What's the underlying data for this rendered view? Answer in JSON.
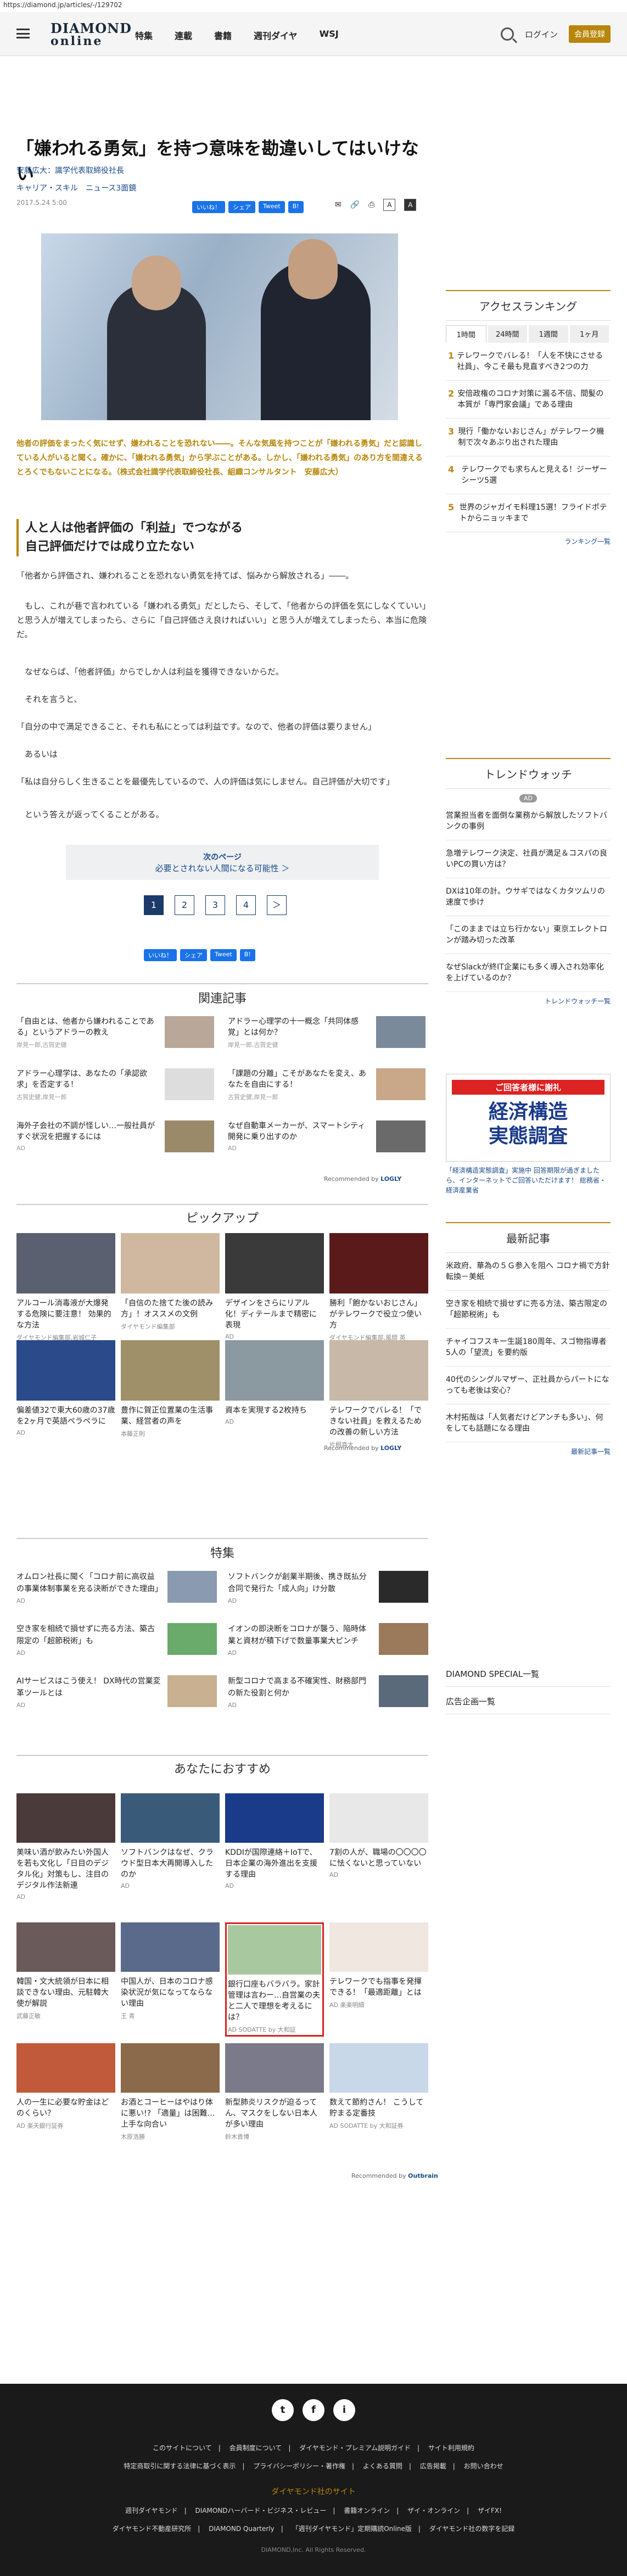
{
  "url": "https://diamond.jp/articles/-/129702",
  "header": {
    "logo1": "DIAMOND",
    "logo2": "online",
    "nav": [
      "特集",
      "連載",
      "書籍",
      "週刊ダイヤ",
      "WSJ"
    ],
    "login": "ログイン",
    "member": "会員登録"
  },
  "article": {
    "title": "「嫌われる勇気」を持つ意味を勘違いしてはいけない",
    "author": "安藤広大：識学代表取締役社長",
    "tags": "キャリア・スキル　ニュース3面鏡",
    "date": "2017.5.24 5:00",
    "share": [
      "いいね！",
      "シェア",
      "Tweet",
      "B!"
    ],
    "font_a": "A",
    "font_b": "A",
    "lead": "他者の評価をまったく気にせず、嫌われることを恐れない――。そんな気風を持つことが「嫌われる勇気」だと認識している人がいると聞く。確かに、「嫌われる勇気」から学ぶことがある。しかし、「嫌われる勇気」のあり方を間違えるとろくでもないことになる。（株式会社識学代表取締役社長、組織コンサルタント　安藤広大）",
    "subhead1": "人と人は他者評価の「利益」でつながる",
    "subhead2": "自己評価だけでは成り立たない",
    "paras": [
      "「他者から評価され、嫌われることを恐れない勇気を持てば、悩みから解放される」――。",
      "　もし、これが巷で言われている「嫌われる勇気」だとしたら、そして、「他者からの評価を気にしなくていい」と思う人が増えてしまったら、さらに「自己評価さえ良ければいい」と思う人が増えてしまったら、本当に危険だ。",
      "　なぜならば、「他者評価」からでしか人は利益を獲得できないからだ。",
      "　それを言うと、",
      "「自分の中で満足できること、それも私にとっては利益です。なので、他者の評価は要りません」",
      "　あるいは",
      "「私は自分らしく生きることを最優先しているので、人の評価は気にしません。自己評価が大切です」",
      "　という答えが返ってくることがある。"
    ],
    "next_a": "次のページ",
    "next_b": "必要とされない人間になる可能性 ＞",
    "pages": [
      "1",
      "2",
      "3",
      "4",
      "＞"
    ]
  },
  "related": {
    "title": "関連記事",
    "items": [
      {
        "t": "「自由とは、他者から嫌われることである」というアドラーの教え",
        "s": "岸見一郎,古賀史健"
      },
      {
        "t": "アドラー心理学の十一概念「共同体感覚」とは何か？",
        "s": "岸見一郎,古賀史健"
      },
      {
        "t": "アドラー心理学は、あなたの「承認欲求」を否定する！",
        "s": "古賀史健,岸見一郎"
      },
      {
        "t": "「課題の分離」こそがあなたを変え、あなたを自由にする！",
        "s": "古賀史健,岸見一郎"
      },
      {
        "t": "海外子会社の不調が怪しい…一般社員がすぐ状況を把握するには",
        "s": "AD"
      },
      {
        "t": "なぜ自動車メーカーが、スマートシティ開発に乗り出すのか",
        "s": "AD"
      }
    ],
    "rec": "Recommended by",
    "rec_brand": "LOGLY"
  },
  "pickup": {
    "title": "ピックアップ",
    "items": [
      {
        "t": "アルコール消毒液が大爆発する危険に要注意！ 効果的な方法",
        "s": "ダイヤモンド編集部,岩城仁子"
      },
      {
        "t": "「自信のた捨てた後の読み方」！オススメの文例",
        "s": "ダイヤモンド編集部"
      },
      {
        "t": "デザインをさらにリアル化！ディテールまで精密に表現",
        "s": "AD"
      },
      {
        "t": "勝利「飽かないおじさん」がテレワークで役立つ使い方",
        "s": "ダイヤモンド編集部,風間 英"
      },
      {
        "t": "偏差値32で東大60歳の37歳を2ヶ月で英語ペラペラに",
        "s": "AD"
      },
      {
        "t": "豊作に賀正位置業の生活事業、経営者の声を",
        "s": "本藤正則"
      },
      {
        "t": "資本を実現する2枚持ち",
        "s": "AD"
      },
      {
        "t": "テレワークでバレる！「できない社員」を救えるための改善の新しい方法",
        "s": "片桐真太"
      }
    ],
    "rec": "Recommended by",
    "rec_brand": "LOGLY"
  },
  "feature": {
    "title": "特集",
    "items": [
      {
        "t": "オムロン社長に聞く「コロナ前に高収益の事業体制事業を充る決断ができた理由」",
        "s": "AD"
      },
      {
        "t": "ソフトバンクが創業半期後、携き既払分合同で発行た「成人向」け分散",
        "s": "AD"
      },
      {
        "t": "空き家を相続で損せずに売る方法、築古限定の「超節税術」も",
        "s": "AD"
      },
      {
        "t": "イオンの即決断をコロナが襲う、陥時体業と資材が積下げで数量事業大ピンチ",
        "s": "AD"
      },
      {
        "t": "AIサービスはこう使え！ DX時代の営業変革ツールとは",
        "s": "AD"
      },
      {
        "t": "新型コロナで高まる不確実性、財務部門の新た役割と何か",
        "s": "AD"
      }
    ]
  },
  "osusume": {
    "title": "あなたにおすすめ",
    "items": [
      {
        "t": "美味い酒が飲みたい外国人を若も文化し「日目のデジタル化」対策もし、注目のデジタル作法新連",
        "s": "AD"
      },
      {
        "t": "ソフトバンクはなぜ、クラウド型日本大再開導入したのか",
        "s": "AD"
      },
      {
        "t": "KDDIが国際連絡＋IoTで、日本企業の海外進出を支援する理由",
        "s": "AD"
      },
      {
        "t": "7割の人が、職場の〇〇〇〇に怯くないと思っていない",
        "s": "AD"
      },
      {
        "t": "韓国・文大統領が日本に相談できない理由、元駐韓大使が解説",
        "s": "武藤正敏"
      },
      {
        "t": "中国人が、日本のコロナ感染状況が気になってならない理由",
        "s": "王 青"
      },
      {
        "t": "銀行口座もバラバラ。家計管理は言わー…自営業の夫と二人で理想を考えるには？",
        "s": "AD SODATTE by 大和証"
      },
      {
        "t": "テレワークでも指事を発揮できる！「最適距離」とは",
        "s": "AD 楽楽明細"
      },
      {
        "t": "人の一生に必要な貯金はどのくらい？",
        "s": "AD 楽天銀行証券"
      },
      {
        "t": "お酒とコーヒーはやはり体に悪い!? 「適量」は困難…上手な向合い",
        "s": "木原浩勝"
      },
      {
        "t": "新型肺炎リスクが迫るってん、マスクをしない日本人が多い理由",
        "s": "鈴木貴博"
      },
      {
        "t": "数えて節約さん！ こうして貯まる定番技",
        "s": "AD SODATTE by 大和証券"
      }
    ],
    "rec": "Recommended by",
    "rec_brand": "Outbrain"
  },
  "ranking": {
    "title": "アクセスランキング",
    "tabs": [
      "1時間",
      "24時間",
      "1週間",
      "1ヶ月"
    ],
    "items": [
      "テレワークでバレる！「人を不快にさせる社員」、今こそ最も見直すべき2つの力",
      "安倍政権のコロナ対策に漏る不信、間髪の本質が「専門家会議」である理由",
      "現行「働かないおじさん」がテレワーク機制で次々あぶり出された理由",
      "テレワークでも求ちんと見える！ジーザーシーツ5選",
      "世界のジャガイモ料理15選！フライドポテトからニョッキまで"
    ],
    "more": "ランキング一覧"
  },
  "trend": {
    "title": "トレンドウォッチ",
    "badge": "AD",
    "items": [
      "営業担当者を面倒な業務から解放したソフトバンクの事例",
      "急増テレワーク決定、社員が満足＆コスパの良いPCの買い方は？",
      "DXは10年の計。ウサギではなくカタツムリの速度で歩け",
      "「このままでは立ち行かない」東京エレクトロンが踏み切った改革",
      "なぜSlackが終IT企業にも多く導入され効率化を上げているのか？"
    ],
    "more": "トレンドウォッチ一覧"
  },
  "ad_side": {
    "a1": "ご回答者様に謝礼",
    "a2a": "経済構造",
    "a2b": "実態調査",
    "cap": "「経済構造実態調査」実施中 回答期限が過ぎましたら、インターネットでご回答いただけます！ 総務省・経済産業省"
  },
  "latest": {
    "title": "最新記事",
    "items": [
      "米政府、華為の５Ｇ参入を阻へ コロナ禍で方針転換－美紙",
      "空き家を相続で損せずに売る方法、築古限定の「超節税術」も",
      "チャイコフスキー生誕180周年、スゴ物指導者5人の「望流」を要約版",
      "40代のシングルマザー、正社員からパートになっても老後は安心？",
      "木村拓哉は「人気者だけどアンチも多い」、何をしても話題になる理由"
    ],
    "more": "最新記事一覧"
  },
  "side_links": [
    "DIAMOND SPECIAL一覧",
    "広告企画一覧"
  ],
  "footer": {
    "social": [
      "t",
      "f",
      "i"
    ],
    "row1": [
      "このサイトについて",
      "会員制度について",
      "ダイヤモンド・プレミアム説明ガイド",
      "サイト利用規約"
    ],
    "row2": [
      "特定商取引に関する法律に基づく表示",
      "プライバシーポリシー・著作権",
      "よくある質問",
      "広告掲載",
      "お問い合わせ"
    ],
    "site_title": "ダイヤモンド社のサイト",
    "row3": [
      "週刊ダイヤモンド",
      "DIAMONDハーバード・ビジネス・レビュー",
      "書籍オンライン",
      "ザイ・オンライン",
      "ザイFX!"
    ],
    "row4": [
      "ダイヤモンド不動産研究所",
      "DIAMOND Quarterly",
      "「週刊ダイヤモンド」定期購読Online版",
      "ダイヤモンド社の数字を記録"
    ],
    "copy": "DIAMOND,Inc. All Rights Reserved."
  }
}
